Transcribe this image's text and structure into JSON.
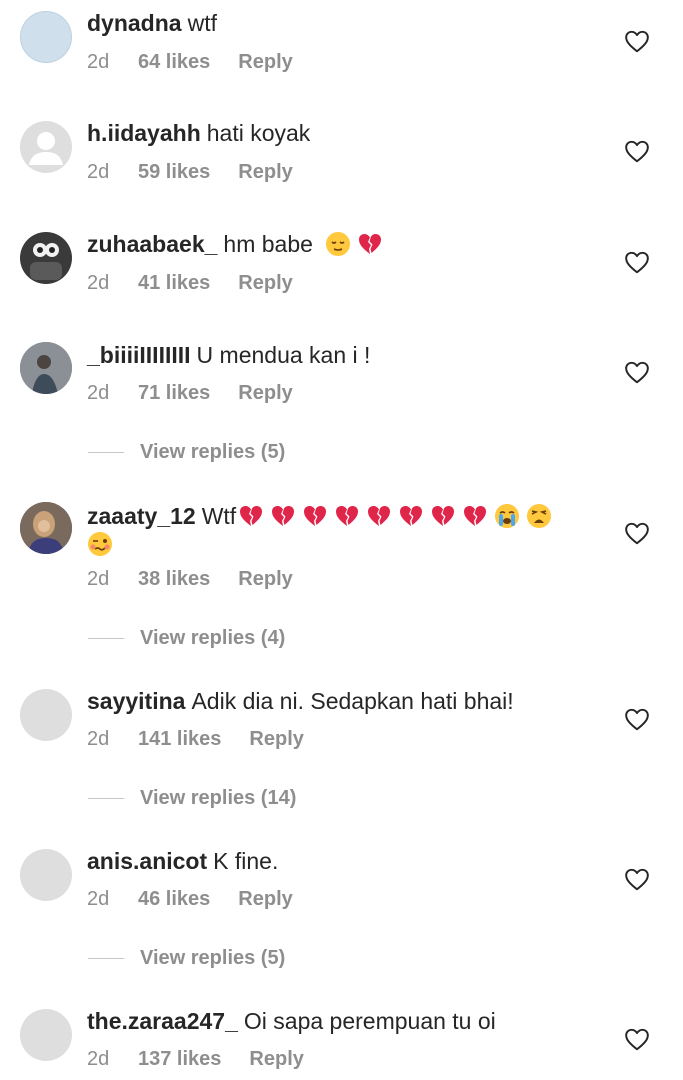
{
  "comments": [
    {
      "username": "dynadna",
      "text": "wtf",
      "time": "2d",
      "likes": "64 likes",
      "reply": "Reply"
    },
    {
      "username": "h.iidayahh",
      "text": "hati koyak",
      "time": "2d",
      "likes": "59 likes",
      "reply": "Reply"
    },
    {
      "username": "zuhaabaek_",
      "text": "hm babe",
      "time": "2d",
      "likes": "41 likes",
      "reply": "Reply"
    },
    {
      "username": "_biiiiIIIIIIII",
      "text": "U mendua kan i !",
      "time": "2d",
      "likes": "71 likes",
      "reply": "Reply",
      "view_replies": "View replies (5)"
    },
    {
      "username": "zaaaty_12",
      "text": "Wtf",
      "time": "2d",
      "likes": "38 likes",
      "reply": "Reply",
      "view_replies": "View replies (4)"
    },
    {
      "username": "sayyitina",
      "text": "Adik dia ni. Sedapkan hati bhai!",
      "time": "2d",
      "likes": "141 likes",
      "reply": "Reply",
      "view_replies": "View replies (14)"
    },
    {
      "username": "anis.anicot",
      "text": "K fine.",
      "time": "2d",
      "likes": "46 likes",
      "reply": "Reply",
      "view_replies": "View replies (5)"
    },
    {
      "username": "the.zaraa247_",
      "text": "Oi sapa perempuan tu oi",
      "time": "2d",
      "likes": "137 likes",
      "reply": "Reply"
    }
  ],
  "emoji_names": [
    "relieved-face-emoji",
    "broken-heart-emoji",
    "loudly-crying-face-emoji",
    "weary-face-emoji",
    "woozy-face-emoji"
  ],
  "colors": {
    "text": "#262626",
    "meta": "#8e8e8e",
    "broken_heart": "#e0254a",
    "emoji_yellow": "#ffc83d"
  }
}
